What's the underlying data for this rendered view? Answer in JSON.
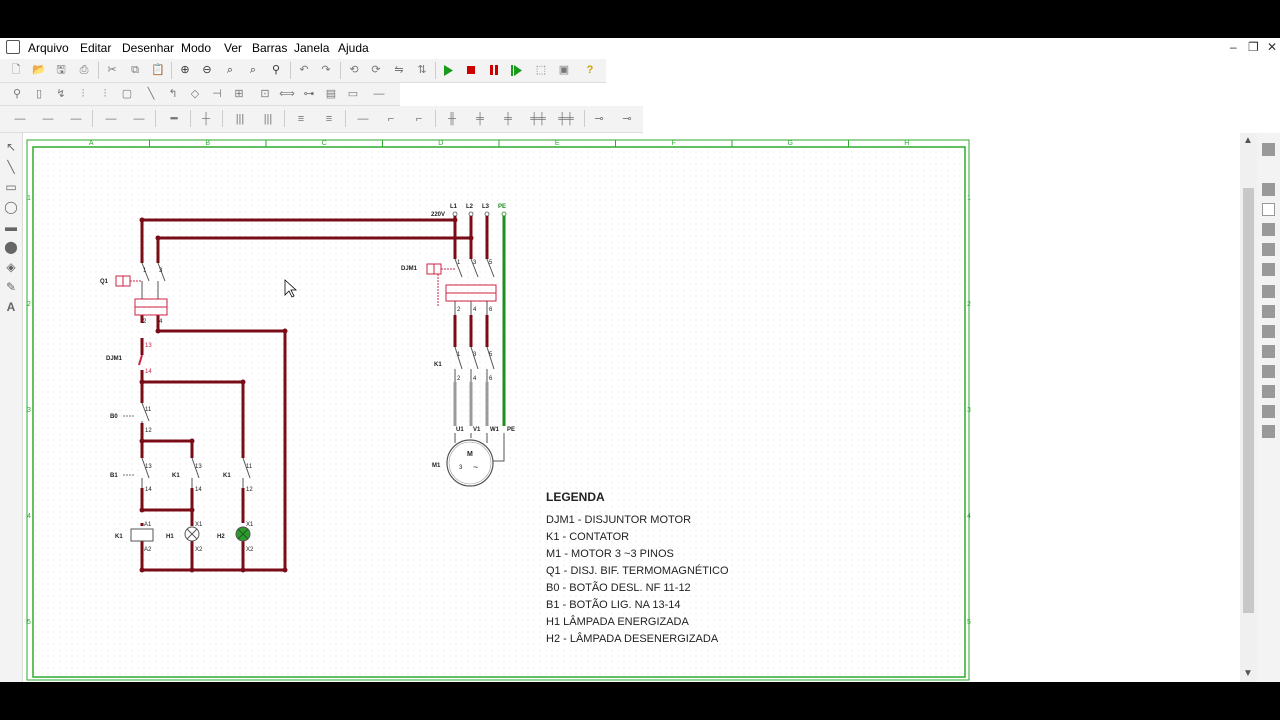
{
  "menu": {
    "items": [
      "Arquivo",
      "Editar",
      "Desenhar",
      "Modo",
      "Ver",
      "Barras",
      "Janela",
      "Ajuda"
    ]
  },
  "window_controls": {
    "minimize": "–",
    "restore": "❐",
    "close": "✕"
  },
  "toolbar": {
    "icons": [
      "new-icon",
      "open-icon",
      "save-icon",
      "print-icon",
      "cut-icon",
      "copy-icon",
      "paste-icon",
      "zoom-in-icon",
      "zoom-out-icon",
      "zoom-fit-icon",
      "zoom-window-icon",
      "find-icon",
      "undo-icon",
      "redo-icon",
      "rotate-left-icon",
      "rotate-right-icon",
      "mirror-icon",
      "flip-icon",
      "run-icon",
      "stop-icon",
      "pause-icon",
      "step-icon",
      "component-icon",
      "settings-icon",
      "help-icon"
    ],
    "colors": {
      "run": "#1a9a1a",
      "stop": "#cc0000",
      "pause": "#cc0000",
      "step": "#1a9a1a",
      "help": "#c9a400"
    }
  },
  "sheet": {
    "columns": [
      "A",
      "B",
      "C",
      "D",
      "E",
      "F",
      "G",
      "H"
    ],
    "rows": [
      "1",
      "2",
      "3",
      "4",
      "5"
    ],
    "border_color": "#2eaa2e",
    "wire_color": "#7a0c17",
    "bus_colors": {
      "L1": "#7a0c17",
      "L2": "#7a0c17",
      "L3": "#7a0c17",
      "PE": "#1e8c1e",
      "motor": "#9a9a9a"
    }
  },
  "circuit_labels": {
    "voltage": "220V",
    "phases": [
      "L1",
      "L2",
      "L3",
      "PE"
    ],
    "q1": "Q1",
    "djm1": "DJM1",
    "k1": "K1",
    "b0": "B0",
    "b1": "B1",
    "h1": "H1",
    "h2": "H2",
    "m1": "M1",
    "motor_terminals": [
      "U1",
      "V1",
      "W1",
      "PE"
    ],
    "terminal_numbers": {
      "q1_top": [
        "1",
        "3"
      ],
      "q1_bottom": [
        "2",
        "4"
      ],
      "djm1_control_top": "13",
      "djm1_control_bottom": "14",
      "b0_top": "11",
      "b0_bottom": "12",
      "b1_top": "13",
      "b1_bottom": "14",
      "k1_seal_top": "13",
      "k1_seal_bottom": "14",
      "k1_nc_top": "11",
      "k1_nc_bottom": "12",
      "coil_top": "A1",
      "coil_bottom": "A2",
      "lamp_top": "X1",
      "lamp_bottom": "X2",
      "power_top": [
        "1",
        "3",
        "5"
      ],
      "power_bottom": [
        "2",
        "4",
        "6"
      ]
    },
    "motor_symbol": {
      "letter": "M",
      "phase": "3",
      "tilde": "~"
    }
  },
  "legend": {
    "title": "LEGENDA",
    "items": [
      "DJM1 - DISJUNTOR MOTOR",
      "K1 - CONTATOR",
      "M1 - MOTOR 3 ~3 PINOS",
      "Q1 - DISJ. BIF. TERMOMAGNÉTICO",
      "B0 - BOTÃO DESL. NF 11-12",
      "B1 - BOTÃO LIG. NA 13-14",
      "H1 LÂMPADA ENERGIZADA",
      "H2 - LÂMPADA DESENERGIZADA"
    ]
  },
  "lamp_colors": {
    "h1": "#ffffff",
    "h2": "#2f9a2f"
  }
}
